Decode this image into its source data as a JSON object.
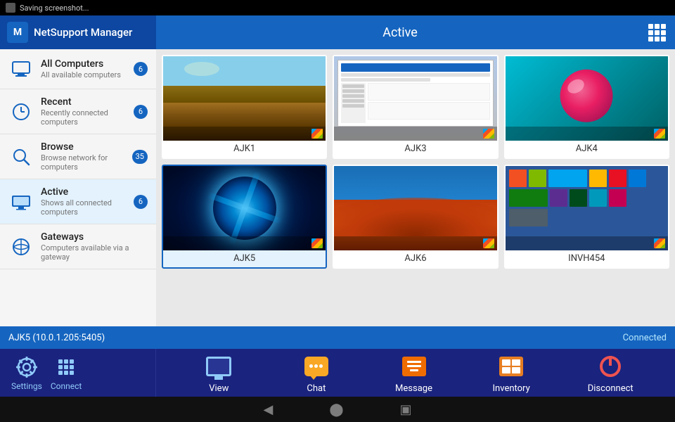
{
  "statusBar": {
    "icon": "screenshot",
    "text": "Saving screenshot..."
  },
  "header": {
    "appTitle": "NetSupport Manager",
    "mainTitle": "Active",
    "logoText": "M"
  },
  "sidebar": {
    "items": [
      {
        "id": "all-computers",
        "label": "All Computers",
        "sublabel": "All available computers",
        "badge": "6",
        "active": false
      },
      {
        "id": "recent",
        "label": "Recent",
        "sublabel": "Recently connected computers",
        "badge": "6",
        "active": false
      },
      {
        "id": "browse",
        "label": "Browse",
        "sublabel": "Browse network for computers",
        "badge": "35",
        "active": false
      },
      {
        "id": "active",
        "label": "Active",
        "sublabel": "Shows all connected computers",
        "badge": "6",
        "active": true
      },
      {
        "id": "gateways",
        "label": "Gateways",
        "sublabel": "Computers available via a gateway",
        "badge": "",
        "active": false
      }
    ]
  },
  "computers": [
    {
      "id": "AJK1",
      "label": "AJK1",
      "selected": false,
      "screen": "screen-ajk1"
    },
    {
      "id": "AJK3",
      "label": "AJK3",
      "selected": false,
      "screen": "screen-ajk3"
    },
    {
      "id": "AJK4",
      "label": "AJK4",
      "selected": false,
      "screen": "screen-ajk4"
    },
    {
      "id": "AJK5",
      "label": "AJK5",
      "selected": true,
      "screen": "screen-ajk5"
    },
    {
      "id": "AJK6",
      "label": "AJK6",
      "selected": false,
      "screen": "screen-ajk6"
    },
    {
      "id": "INVH454",
      "label": "INVH454",
      "selected": false,
      "screen": "screen-invh454"
    }
  ],
  "statusBar2": {
    "computerInfo": "AJK5 (10.0.1.205:5405)",
    "connectionStatus": "Connected"
  },
  "toolbar": {
    "settings": "Settings",
    "connect": "Connect",
    "actions": [
      {
        "id": "view",
        "label": "View",
        "icon": "monitor-icon"
      },
      {
        "id": "chat",
        "label": "Chat",
        "icon": "chat-icon"
      },
      {
        "id": "message",
        "label": "Message",
        "icon": "message-icon"
      },
      {
        "id": "inventory",
        "label": "Inventory",
        "icon": "inventory-icon"
      },
      {
        "id": "disconnect",
        "label": "Disconnect",
        "icon": "disconnect-icon"
      }
    ]
  },
  "navBar": {
    "back": "◀",
    "home": "⬤",
    "recents": "▣"
  }
}
